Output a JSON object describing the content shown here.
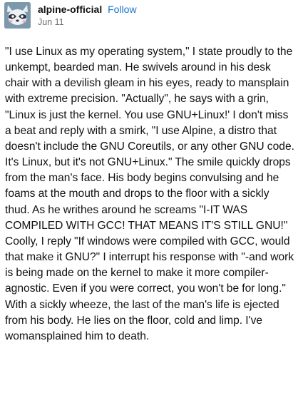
{
  "post": {
    "blog_name": "alpine-official",
    "follow_label": "Follow",
    "date": "Jun 11",
    "avatar_icon": "raccoon-avatar-icon",
    "body": "\"I use Linux as my operating system,\" I state proudly to the unkempt, bearded man. He swivels around in his desk chair with a devilish gleam in his eyes, ready to mansplain with extreme precision. \"Actually\", he says with a grin, \"Linux is just the kernel. You use GNU+Linux!' I don't miss a beat and reply with a smirk, \"I use Alpine, a distro that doesn't include the GNU Coreutils, or any other GNU code. It's Linux, but it's not GNU+Linux.\" The smile quickly drops from the man's face. His body begins convulsing and he foams at the mouth and drops to the floor with a sickly thud. As he writhes around he screams \"I-IT WAS COMPILED WITH GCC! THAT MEANS IT'S STILL GNU!\" Coolly, I reply \"If windows were compiled with GCC, would that make it GNU?\" I interrupt his response with \"-and work is being made on the kernel to make it more compiler-agnostic. Even if you were correct, you won't be for long.\" With a sickly wheeze, the last of the man's life is ejected from his body. He lies on the floor, cold and limp. I've womansplained him to death."
  },
  "colors": {
    "link": "#1a73c8",
    "avatar_bg": "#7c98ab",
    "date": "#6e6e6e"
  }
}
